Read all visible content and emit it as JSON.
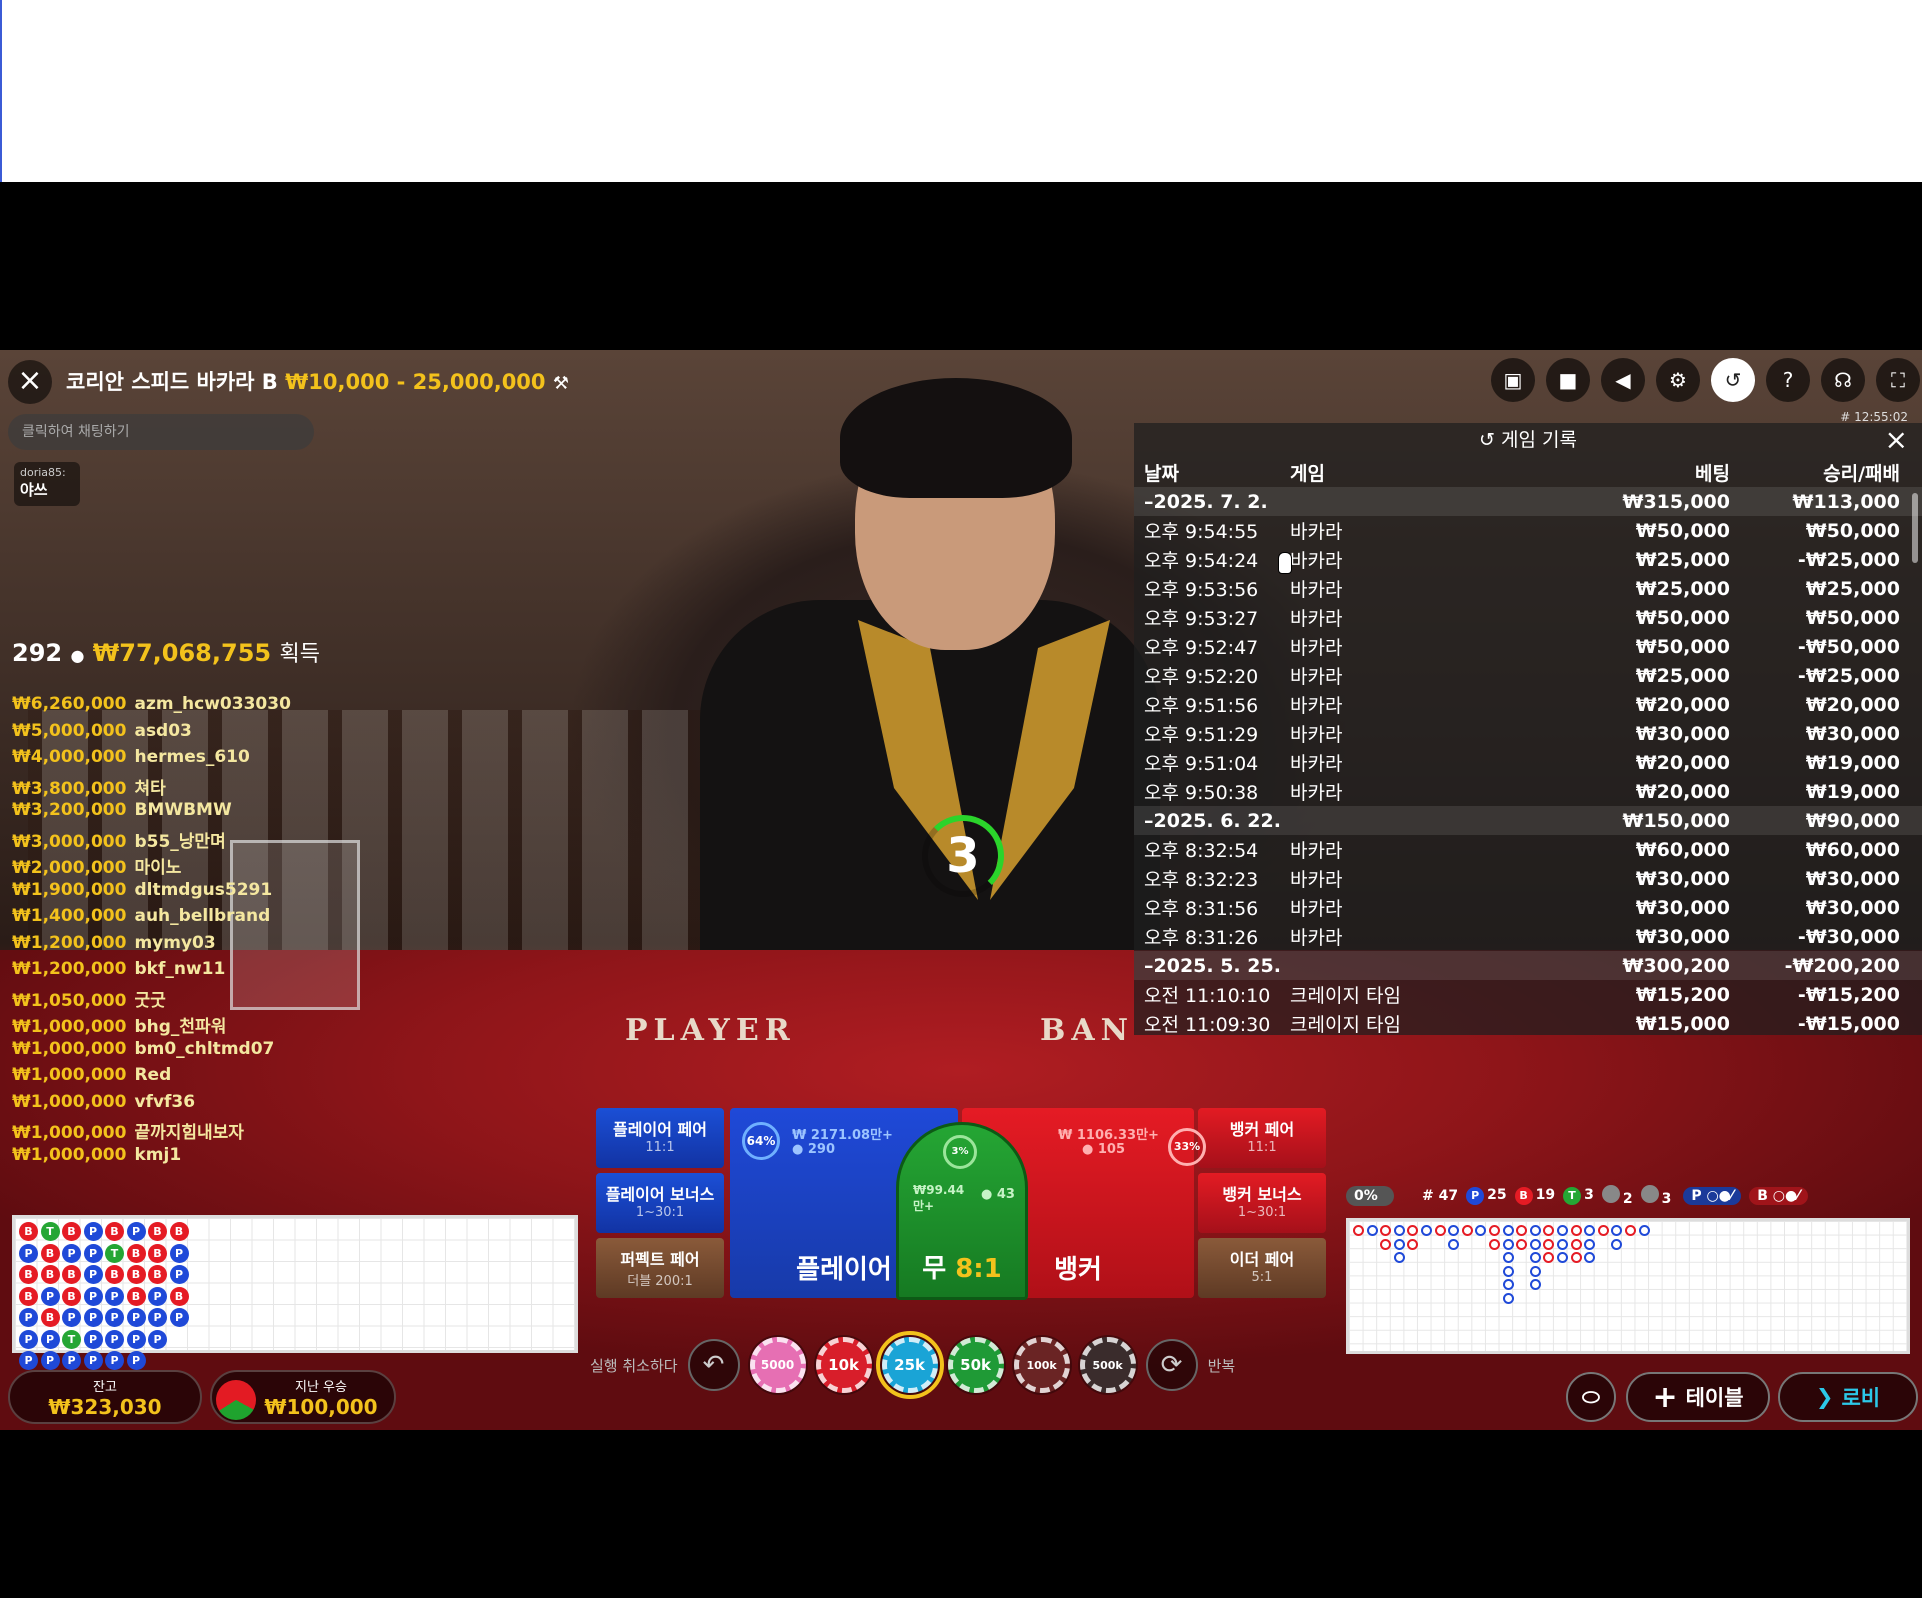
{
  "header": {
    "title": "코리안 스피드 바카라 B",
    "limits": "₩10,000 - 25,000,000",
    "table_code": "# 12:55:02"
  },
  "chat": {
    "placeholder": "클릭하여 채팅하기",
    "message_user": "doria85:",
    "message_text": "야쓰"
  },
  "winners": {
    "count": "292",
    "total": "₩77,068,755",
    "label": "획득",
    "list": [
      {
        "amount": "₩6,260,000",
        "name": "azm_hcw033030"
      },
      {
        "amount": "₩5,000,000",
        "name": "asd03"
      },
      {
        "amount": "₩4,000,000",
        "name": "hermes_610"
      },
      {
        "amount": "₩3,800,000",
        "name": "쳐타"
      },
      {
        "amount": "₩3,200,000",
        "name": "BMWBMW"
      },
      {
        "amount": "₩3,000,000",
        "name": "b55_낭만며"
      },
      {
        "amount": "₩2,000,000",
        "name": "마이노"
      },
      {
        "amount": "₩1,900,000",
        "name": "dltmdgus5291"
      },
      {
        "amount": "₩1,400,000",
        "name": "auh_bellbrand"
      },
      {
        "amount": "₩1,200,000",
        "name": "mymy03"
      },
      {
        "amount": "₩1,200,000",
        "name": "bkf_nw11"
      },
      {
        "amount": "₩1,050,000",
        "name": "굿굿"
      },
      {
        "amount": "₩1,000,000",
        "name": "bhg_천파워"
      },
      {
        "amount": "₩1,000,000",
        "name": "bm0_chltmd07"
      },
      {
        "amount": "₩1,000,000",
        "name": "Red"
      },
      {
        "amount": "₩1,000,000",
        "name": "vfvf36"
      },
      {
        "amount": "₩1,000,000",
        "name": "끝까지힘내보자"
      },
      {
        "amount": "₩1,000,000",
        "name": "kmj1"
      }
    ]
  },
  "toolbar_icons": [
    "chat-icon",
    "video-icon",
    "sound-icon",
    "settings-icon",
    "history-icon",
    "help-icon",
    "support-icon",
    "fullscreen-icon"
  ],
  "history": {
    "title": "게임 기록",
    "columns": {
      "date": "날짜",
      "game": "게임",
      "bet": "베팅",
      "result": "승리/패배"
    },
    "rows": [
      {
        "type": "date",
        "date": "–2025. 7. 2.",
        "game": "",
        "bet": "₩315,000",
        "result": "₩113,000"
      },
      {
        "type": "game",
        "date": "오후 9:54:55",
        "game": "바카라",
        "bet": "₩50,000",
        "result": "₩50,000"
      },
      {
        "type": "game",
        "date": "오후 9:54:24",
        "game": "바카라",
        "bet": "₩25,000",
        "result": "-₩25,000"
      },
      {
        "type": "game",
        "date": "오후 9:53:56",
        "game": "바카라",
        "bet": "₩25,000",
        "result": "₩25,000"
      },
      {
        "type": "game",
        "date": "오후 9:53:27",
        "game": "바카라",
        "bet": "₩50,000",
        "result": "₩50,000"
      },
      {
        "type": "game",
        "date": "오후 9:52:47",
        "game": "바카라",
        "bet": "₩50,000",
        "result": "-₩50,000"
      },
      {
        "type": "game",
        "date": "오후 9:52:20",
        "game": "바카라",
        "bet": "₩25,000",
        "result": "-₩25,000"
      },
      {
        "type": "game",
        "date": "오후 9:51:56",
        "game": "바카라",
        "bet": "₩20,000",
        "result": "₩20,000"
      },
      {
        "type": "game",
        "date": "오후 9:51:29",
        "game": "바카라",
        "bet": "₩30,000",
        "result": "₩30,000"
      },
      {
        "type": "game",
        "date": "오후 9:51:04",
        "game": "바카라",
        "bet": "₩20,000",
        "result": "₩19,000"
      },
      {
        "type": "game",
        "date": "오후 9:50:38",
        "game": "바카라",
        "bet": "₩20,000",
        "result": "₩19,000"
      },
      {
        "type": "date",
        "date": "–2025. 6. 22.",
        "game": "",
        "bet": "₩150,000",
        "result": "₩90,000"
      },
      {
        "type": "game",
        "date": "오후 8:32:54",
        "game": "바카라",
        "bet": "₩60,000",
        "result": "₩60,000"
      },
      {
        "type": "game",
        "date": "오후 8:32:23",
        "game": "바카라",
        "bet": "₩30,000",
        "result": "₩30,000"
      },
      {
        "type": "game",
        "date": "오후 8:31:56",
        "game": "바카라",
        "bet": "₩30,000",
        "result": "₩30,000"
      },
      {
        "type": "game",
        "date": "오후 8:31:26",
        "game": "바카라",
        "bet": "₩30,000",
        "result": "-₩30,000"
      },
      {
        "type": "date",
        "date": "–2025. 5. 25.",
        "game": "",
        "bet": "₩300,200",
        "result": "-₩200,200"
      },
      {
        "type": "game",
        "date": "오전 11:10:10",
        "game": "크레이지 타임",
        "bet": "₩15,200",
        "result": "-₩15,200"
      },
      {
        "type": "game",
        "date": "오전 11:09:30",
        "game": "크레이지 타임",
        "bet": "₩15,000",
        "result": "-₩15,000"
      }
    ]
  },
  "table_felt": {
    "player": "PLAYER",
    "banker": "BAN"
  },
  "countdown": "3",
  "bets": {
    "player_pair": {
      "label": "플레이어 페어",
      "odds": "11:1"
    },
    "player_bonus": {
      "label": "플레이어 보너스",
      "odds": "1~30:1"
    },
    "perfect_pair": {
      "label": "퍼펙트 페어",
      "odds": "더블 200:1"
    },
    "banker_pair": {
      "label": "뱅커 페어",
      "odds": "11:1"
    },
    "banker_bonus": {
      "label": "뱅커 보너스",
      "odds": "1~30:1"
    },
    "either_pair": {
      "label": "이더 페어",
      "odds": "5:1"
    },
    "player": {
      "label": "플레이어",
      "pct": "64%",
      "amount": "₩ 2171.08만+",
      "players": "290"
    },
    "tie": {
      "label": "무",
      "odds": "8:1",
      "pct": "3%",
      "amount": "₩99.44만+",
      "players": "43"
    },
    "banker": {
      "label": "뱅커",
      "pct": "33%",
      "amount": "₩ 1106.33만+",
      "players": "105"
    }
  },
  "chips": [
    {
      "label": "5000",
      "color": "#e66fb3"
    },
    {
      "label": "10k",
      "color": "#d81e2a"
    },
    {
      "label": "25k",
      "color": "#1aa4d6"
    },
    {
      "label": "50k",
      "color": "#1f9a36"
    },
    {
      "label": "100k",
      "color": "#6a2424"
    },
    {
      "label": "500k",
      "color": "#3a2c2c"
    }
  ],
  "controls": {
    "undo": "실행 취소하다",
    "repeat": "반복"
  },
  "balance": {
    "label": "잔고",
    "value": "₩323,030"
  },
  "last_win": {
    "label": "지난 우승",
    "value": "₩100,000"
  },
  "stats": {
    "progress": "0%",
    "rounds": "# 47",
    "player_wins": "25",
    "banker_wins": "19",
    "ties": "3",
    "player_pairs": "2",
    "banker_pairs": "3",
    "p_label": "P",
    "b_label": "B"
  },
  "bead_road": [
    [
      "B",
      "P",
      "B",
      "B",
      "P",
      "P",
      "P"
    ],
    [
      "T",
      "B",
      "B",
      "P",
      "B",
      "P",
      "P"
    ],
    [
      "B",
      "P",
      "B",
      "B",
      "P",
      "T",
      "P"
    ],
    [
      "P",
      "P",
      "P",
      "P",
      "P",
      "P",
      "P"
    ],
    [
      "B",
      "T",
      "B",
      "P",
      "P",
      "P",
      "P"
    ],
    [
      "P",
      "B",
      "B",
      "B",
      "P",
      "P",
      "P"
    ],
    [
      "B",
      "B",
      "B",
      "P",
      "P",
      "P"
    ],
    [
      "B",
      "P",
      "P",
      "B",
      "P"
    ]
  ],
  "bottom_buttons": {
    "table": "테이블",
    "lobby": "로비"
  },
  "colors": {
    "gold": "#f3c21c",
    "player_blue": "#1f49d8",
    "banker_red": "#e51b24",
    "tie_green": "#25a634"
  }
}
